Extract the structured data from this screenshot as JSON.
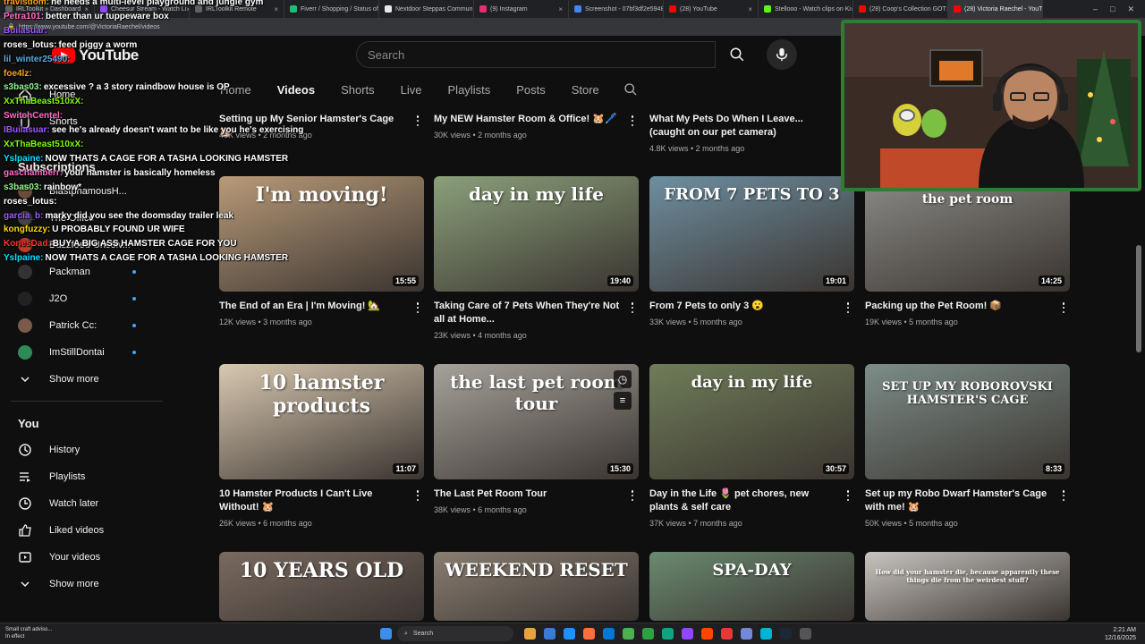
{
  "browser": {
    "tabs": [
      {
        "label": "IRLToolkit » Dashboard",
        "color": "#5f6368"
      },
      {
        "label": "Cheesur Stream - Watch Li",
        "color": "#9146ff"
      },
      {
        "label": "IRLToolkit Remote",
        "color": "#5f6368"
      },
      {
        "label": "Fiverr / Shopping / Status of",
        "color": "#1dbf73"
      },
      {
        "label": "Nextdoor Steppas Commun",
        "color": "#e8e8e8"
      },
      {
        "label": "(9) Instagram",
        "color": "#e1306c"
      },
      {
        "label": "Screenshot - 07bf3df2e5948",
        "color": "#4285f4"
      },
      {
        "label": "(28) YouTube",
        "color": "#ff0000"
      },
      {
        "label": "Stellooo - Watch clips on Ki",
        "color": "#53fc18"
      },
      {
        "label": "(28) Coop's Collection GOT",
        "color": "#ff0000"
      },
      {
        "label": "(28) Victoria Raechel - YouT",
        "color": "#ff0000"
      }
    ],
    "url": "https://www.youtube.com/@VictoriaRaechel/videos"
  },
  "masthead": {
    "logo_text": "YouTube",
    "search_placeholder": "Search"
  },
  "channel_tabs": [
    "Home",
    "Videos",
    "Shorts",
    "Live",
    "Playlists",
    "Posts",
    "Store"
  ],
  "sidebar": {
    "top": [
      {
        "label": "Home",
        "icon": "home-icon"
      },
      {
        "label": "Shorts",
        "icon": "shorts-icon"
      }
    ],
    "subscriptions_header": "Subscriptions",
    "subscriptions": [
      {
        "label": "BlastphamousH...",
        "color": "#6b4b3a",
        "live": false
      },
      {
        "label": "The Office",
        "color": "#444",
        "live": false
      },
      {
        "label": "Buzzfeed Unsolv...",
        "color": "#c0392b",
        "live": false
      },
      {
        "label": "Packman",
        "color": "#333",
        "live": true
      },
      {
        "label": "J2O",
        "color": "#222",
        "live": true
      },
      {
        "label": "Patrick Cc:",
        "color": "#7a5a4a",
        "live": true
      },
      {
        "label": "ImStillDontai",
        "color": "#2e8b57",
        "live": true
      }
    ],
    "show_more_1": "Show more",
    "you_header": "You",
    "you_items": [
      {
        "label": "History",
        "icon": "history-icon"
      },
      {
        "label": "Playlists",
        "icon": "playlists-icon"
      },
      {
        "label": "Watch later",
        "icon": "watch-later-icon"
      },
      {
        "label": "Liked videos",
        "icon": "liked-icon"
      },
      {
        "label": "Your videos",
        "icon": "your-videos-icon"
      }
    ],
    "show_more_2": "Show more"
  },
  "videos_top_row": [
    {
      "title": "Setting up My Senior Hamster's Cage 🐹",
      "meta": "40K views • 2 months ago"
    },
    {
      "title": "My NEW Hamster Room & Office! 🐹🖊️",
      "meta": "30K views • 2 months ago"
    },
    {
      "title": "What My Pets Do When I Leave... (caught on our pet camera)",
      "meta": "4.8K views • 2 months ago"
    }
  ],
  "videos": [
    {
      "title": "The End of an Era | I'm Moving! 🏡",
      "meta": "12K views • 3 months ago",
      "duration": "15:55",
      "thumb_text": "I'm moving!",
      "thumb_bg": "#b89a78"
    },
    {
      "title": "Taking Care of 7 Pets When They're Not all at Home...",
      "meta": "23K views • 4 months ago",
      "duration": "19:40",
      "thumb_text": "day in my life",
      "thumb_bg": "#8aa07a"
    },
    {
      "title": "From 7 Pets to only 3 😮",
      "meta": "33K views • 5 months ago",
      "duration": "19:01",
      "thumb_text": "FROM 7 PETS TO 3",
      "thumb_bg": "#6e8fa0"
    },
    {
      "title": "Packing up the Pet Room! 📦",
      "meta": "19K views • 5 months ago",
      "duration": "14:25",
      "thumb_text": "the pet room",
      "thumb_bg": "#8a8a86"
    },
    {
      "title": "10 Hamster Products I Can't Live Without! 🐹",
      "meta": "26K views • 6 months ago",
      "duration": "11:07",
      "thumb_text": "10 hamster products",
      "thumb_bg": "#d8c8b0"
    },
    {
      "title": "The Last Pet Room Tour",
      "meta": "38K views • 6 months ago",
      "duration": "15:30",
      "thumb_text": "the last pet room tour",
      "thumb_bg": "#a6a29a"
    },
    {
      "title": "Day in the Life 🌷 pet chores, new plants & self care",
      "meta": "37K views • 7 months ago",
      "duration": "30:57",
      "thumb_text": "day in my life",
      "thumb_bg": "#6f7d58"
    },
    {
      "title": "Set up my Robo Dwarf Hamster's Cage with me! 🐹",
      "meta": "50K views • 5 months ago",
      "duration": "8:33",
      "thumb_text": "SET UP MY ROBOROVSKI HAMSTER'S CAGE",
      "thumb_bg": "#7c8d88"
    },
    {
      "title": "",
      "meta": "",
      "duration": "",
      "thumb_text": "10 YEARS OLD",
      "thumb_bg": "#7a6a60"
    },
    {
      "title": "",
      "meta": "",
      "duration": "",
      "thumb_text": "WEEKEND RESET",
      "thumb_bg": "#8a7e72"
    },
    {
      "title": "",
      "meta": "",
      "duration": "",
      "thumb_text": "SPA-DAY",
      "thumb_bg": "#6a8a70"
    },
    {
      "title": "",
      "meta": "",
      "duration": "",
      "thumb_text": "How did your hamster die, because apparently these things die from the weirdest stuff?",
      "thumb_bg": "#c8c4be"
    }
  ],
  "chat": [
    {
      "user": "travisdom:",
      "text": "he needs a multi-level playground and jungle gym",
      "color": "#ff9f1a"
    },
    {
      "user": "Petra101:",
      "text": "better than ur tuppeware box",
      "color": "#ff6ec7"
    },
    {
      "user": "Builasuar:",
      "text": "",
      "color": "#9b59ff"
    },
    {
      "user": "roses_lotus:",
      "text": "feed piggy a worm",
      "color": "#ffffff"
    },
    {
      "user": "lil_winter25490:",
      "text": "",
      "color": "#5dade2"
    },
    {
      "user": "foe4lz:",
      "text": "",
      "color": "#ff9f1a"
    },
    {
      "user": "s3bas03:",
      "text": "excessive ? a 3 story raindbow house is OP",
      "color": "#8ef58e"
    },
    {
      "user": "XxThaBeast510xX:",
      "text": "",
      "color": "#7cfc00"
    },
    {
      "user": "SwitchCentel:",
      "text": "",
      "color": "#ff6ec7"
    },
    {
      "user": "IBuilasuar:",
      "text": "see he's already doesn't want to be like you he's exercising",
      "color": "#9b59ff"
    },
    {
      "user": "XxThaBeast510xX:",
      "text": "",
      "color": "#7cfc00"
    },
    {
      "user": "Yslpaine:",
      "text": "NOW THATS A CAGE FOR A TASHA LOOKING HAMSTER",
      "color": "#00e5ff"
    },
    {
      "user": "gaschamberr:",
      "text": "your hamster is basically homeless",
      "color": "#ff6ec7"
    },
    {
      "user": "s3bas03:",
      "text": "rainbow*",
      "color": "#8ef58e"
    },
    {
      "user": "roses_lotus:",
      "text": "",
      "color": "#ffffff"
    },
    {
      "user": "garcia_b:",
      "text": "marky did you see the doomsday trailer leak",
      "color": "#9b59ff"
    },
    {
      "user": "kongfuzzy:",
      "text": "U PROBABLY FOUND UR WIFE",
      "color": "#ffd700"
    },
    {
      "user": "KonesDad:",
      "text": "BUY A BIG ASS HAMSTER CAGE FOR YOU",
      "color": "#ff3030"
    },
    {
      "user": "Yslpaine:",
      "text": "NOW THATS A CAGE FOR A TASHA LOOKING HAMSTER",
      "color": "#00e5ff"
    }
  ],
  "taskbar": {
    "weather": "Small craft adviso...\nIn effect",
    "search_placeholder": "Search",
    "time": "2:21 AM",
    "date": "12/16/2025"
  },
  "colors": {
    "background": "#0f0f0f",
    "accent_red": "#ff0000",
    "live_dot": "#3ea6ff"
  }
}
